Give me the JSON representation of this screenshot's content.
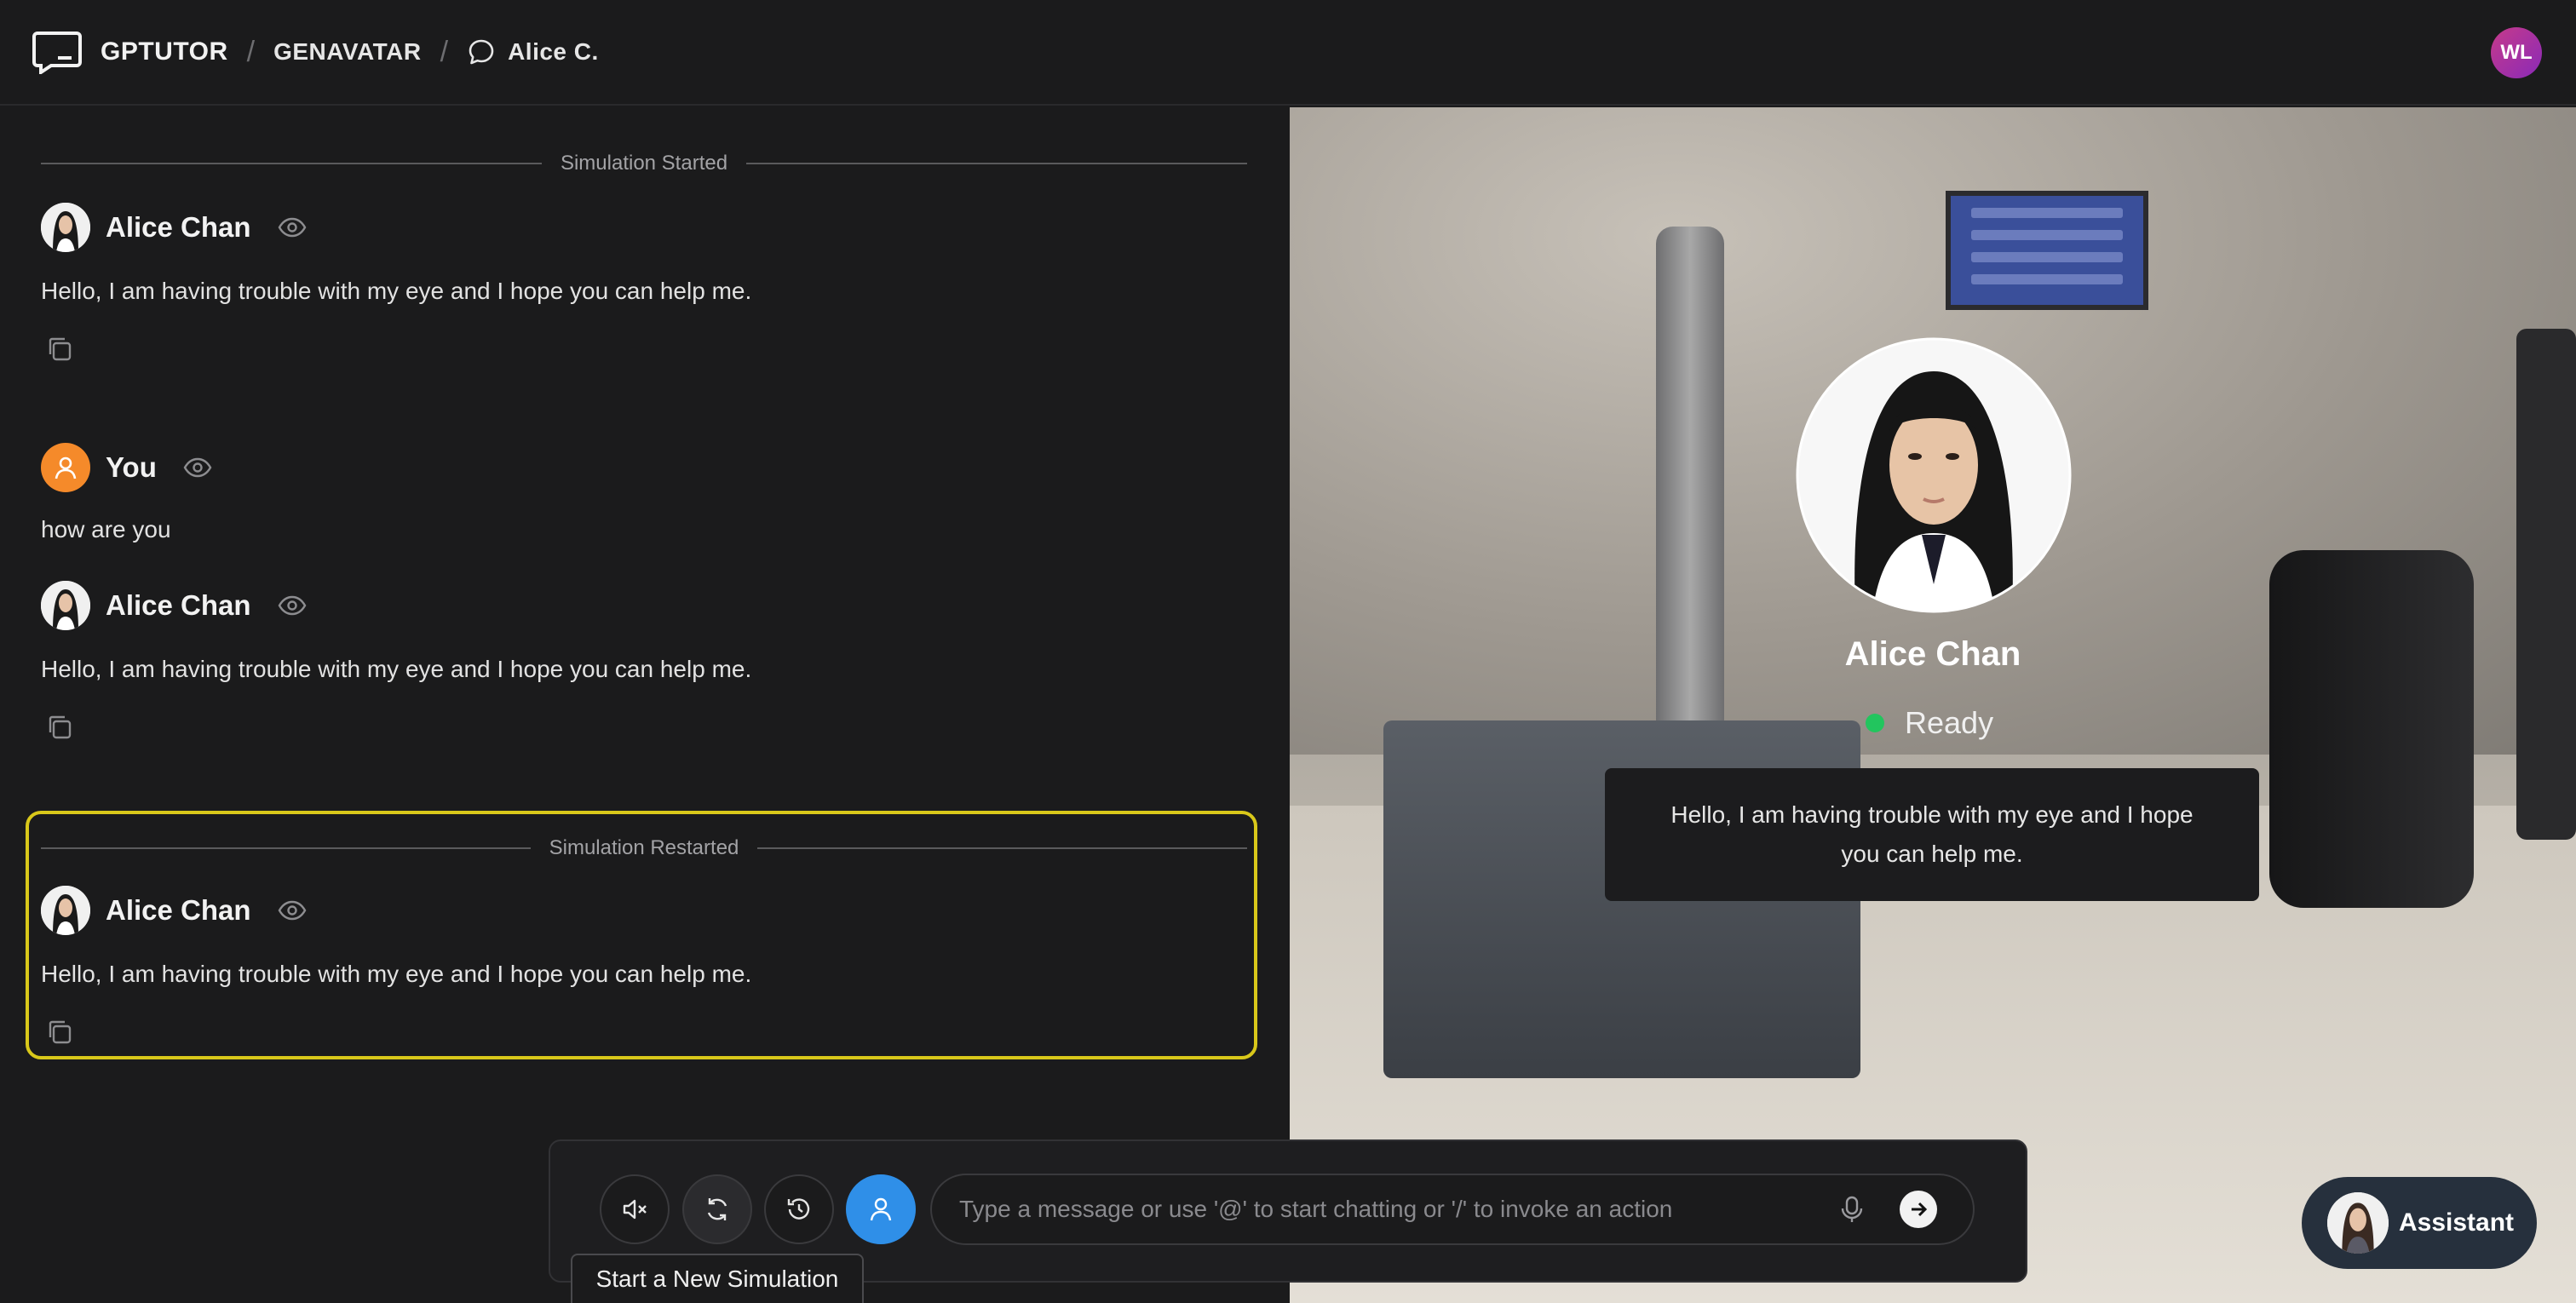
{
  "app": {
    "name": "GPTUTOR",
    "breadcrumb_section": "GENAVATAR",
    "breadcrumb_chat": "Alice C.",
    "user_initials": "WL"
  },
  "chat": {
    "divider_started": "Simulation Started",
    "divider_restarted": "Simulation Restarted",
    "messages": [
      {
        "sender": "Alice Chan",
        "text": "Hello, I am having trouble with my eye and I hope you can help me."
      },
      {
        "sender": "You",
        "text": "how are you"
      },
      {
        "sender": "Alice Chan",
        "text": "Hello, I am having trouble with my eye and I hope you can help me."
      },
      {
        "sender": "Alice Chan",
        "text": "Hello, I am having trouble with my eye and I hope you can help me."
      }
    ]
  },
  "avatar_panel": {
    "name": "Alice Chan",
    "status": "Ready",
    "status_color": "#22c55e",
    "speech": "Hello, I am having trouble with my eye and I hope you can help me."
  },
  "composer": {
    "placeholder": "Type a message or use '@' to start chatting or '/' to invoke an action",
    "tooltip": "Start a New Simulation",
    "accent_color": "#2f8fe8"
  },
  "assistant": {
    "label": "Assistant"
  },
  "colors": {
    "highlight_border": "#d9c81a",
    "you_avatar": "#f58a2a"
  }
}
